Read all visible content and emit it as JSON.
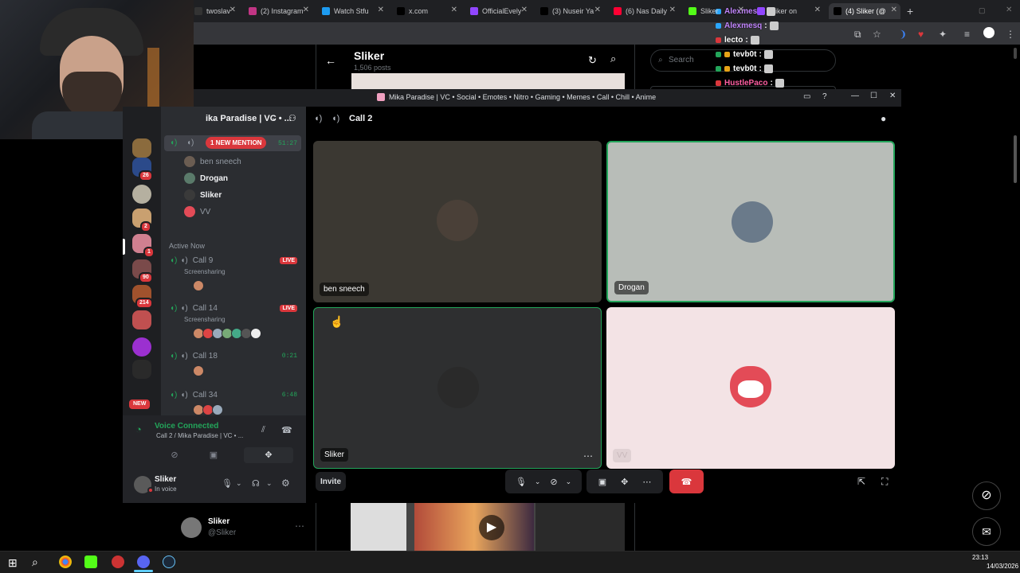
{
  "browser": {
    "tabs": [
      {
        "label": "twoslav",
        "color": "#333"
      },
      {
        "label": "(2) Instagram",
        "color": "#c13584"
      },
      {
        "label": "Watch Stfu",
        "color": "#1d9bf0"
      },
      {
        "label": "x.com",
        "color": "#000"
      },
      {
        "label": "OfficialEvely",
        "color": "#9146ff"
      },
      {
        "label": "(3) Nuseir Ya",
        "color": "#000"
      },
      {
        "label": "(6) Nas Daily",
        "color": "#ff0033"
      },
      {
        "label": "Sliker",
        "color": "#53fc18"
      },
      {
        "label": "Sliker on",
        "color": "#9146ff"
      },
      {
        "label": "(4) Sliker (@",
        "color": "#000"
      }
    ],
    "new_tab": "+"
  },
  "twitter": {
    "profile_name": "Sliker",
    "posts_count": "1,506 posts",
    "search_placeholder": "Search",
    "bottom_user_name": "Sliker",
    "bottom_user_handle": "@Sliker"
  },
  "chat": [
    {
      "user": "Alexmesq",
      "text": "",
      "color": "#c084fc",
      "dot": "#2aa7ff"
    },
    {
      "user": "Alexmesq",
      "text": ":",
      "color": "#c084fc",
      "dot": "#2aa7ff"
    },
    {
      "user": "lecto",
      "text": ":",
      "color": "#ffffff",
      "dot": "#da373c"
    },
    {
      "user": "tevb0t",
      "text": ":",
      "color": "#ffffff",
      "dot": "#23a55a"
    },
    {
      "user": "tevb0t",
      "text": ":",
      "color": "#ffffff",
      "dot": "#23a55a"
    },
    {
      "user": "HustlePaco",
      "text": ":",
      "color": "#ff5fa2",
      "dot": "#da373c"
    },
    {
      "user": "tevb0t",
      "text": ":",
      "color": "#ffffff",
      "dot": "#23a55a"
    },
    {
      "user": "tevb0t",
      "text": ":",
      "color": "#ffffff",
      "dot": "#23a55a"
    }
  ],
  "discord": {
    "window_title": "Mika Paradise | VC • Social • Emotes • Nitro • Gaming • Memes • Call • Chill • Anime",
    "server_name": "ika Paradise | VC • ...",
    "current_channel": "Call 2",
    "mention_badge": "1 NEW MENTION",
    "call_timer": "51:27",
    "voice_users": [
      "ben sneech",
      "Drogan",
      "Sliker",
      "VV"
    ],
    "active_now_label": "Active Now",
    "active_calls": [
      {
        "name": "Call 9",
        "sub": "Screensharing",
        "badge": "LIVE",
        "timer": ""
      },
      {
        "name": "Call 14",
        "sub": "Screensharing",
        "badge": "LIVE",
        "timer": ""
      },
      {
        "name": "Call 18",
        "sub": "",
        "badge": "",
        "timer": "0:21"
      },
      {
        "name": "Call 34",
        "sub": "",
        "badge": "",
        "timer": "6:48"
      }
    ],
    "guild_badges": [
      "26",
      "2",
      "1",
      "90",
      "214"
    ],
    "new_label": "NEW",
    "voice_connected": "Voice Connected",
    "voice_location": "Call 2 / Mika Paradise | VC • ...",
    "user_name": "Sliker",
    "user_status": "In voice",
    "tiles": [
      {
        "name": "ben sneech",
        "bg": "#3b3832",
        "speaking": false
      },
      {
        "name": "Drogan",
        "bg": "#b8bdb8",
        "speaking": true
      },
      {
        "name": "Sliker",
        "bg": "#2e2f30",
        "speaking": false
      },
      {
        "name": "VV",
        "bg": "#f3e3e5",
        "speaking": false
      }
    ],
    "invite_label": "Invite"
  },
  "taskbar": {
    "time": "23:13",
    "date": "14/03/2026"
  },
  "colors": {
    "discord_green": "#23a55a",
    "discord_red": "#da373c",
    "discord_bg": "#2b2d31"
  }
}
